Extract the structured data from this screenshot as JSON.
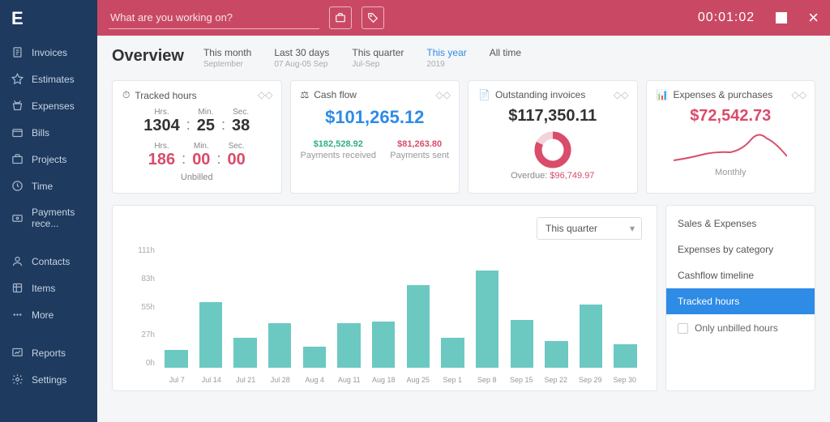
{
  "topbar": {
    "search_placeholder": "What are you working on?",
    "timer": "00:01:02"
  },
  "sidebar": {
    "items": [
      {
        "label": "Invoices",
        "icon": "invoice"
      },
      {
        "label": "Estimates",
        "icon": "estimate"
      },
      {
        "label": "Expenses",
        "icon": "expense"
      },
      {
        "label": "Bills",
        "icon": "bill"
      },
      {
        "label": "Projects",
        "icon": "project"
      },
      {
        "label": "Time",
        "icon": "time"
      },
      {
        "label": "Payments rece...",
        "icon": "payment"
      },
      {
        "label": "Contacts",
        "icon": "contacts"
      },
      {
        "label": "Items",
        "icon": "items"
      },
      {
        "label": "More",
        "icon": "more"
      },
      {
        "label": "Reports",
        "icon": "reports"
      },
      {
        "label": "Settings",
        "icon": "settings"
      }
    ]
  },
  "page_title": "Overview",
  "range_tabs": [
    {
      "label": "This month",
      "sub": "September"
    },
    {
      "label": "Last 30 days",
      "sub": "07 Aug-05 Sep"
    },
    {
      "label": "This quarter",
      "sub": "Jul-Sep"
    },
    {
      "label": "This year",
      "sub": "2019",
      "active": true
    },
    {
      "label": "All time",
      "sub": ""
    }
  ],
  "cards": {
    "tracked": {
      "title": "Tracked hours",
      "labels": {
        "hrs": "Hrs.",
        "min": "Min.",
        "sec": "Sec."
      },
      "total": {
        "h": "1304",
        "m": "25",
        "s": "38"
      },
      "unbilled": {
        "h": "186",
        "m": "00",
        "s": "00"
      },
      "unbilled_label": "Unbilled"
    },
    "cashflow": {
      "title": "Cash flow",
      "amount": "$101,265.12",
      "received": {
        "amount": "$182,528.92",
        "label": "Payments received"
      },
      "sent": {
        "amount": "$81,263.80",
        "label": "Payments sent"
      }
    },
    "outstanding": {
      "title": "Outstanding invoices",
      "amount": "$117,350.11",
      "overdue_label": "Overdue: ",
      "overdue_amount": "$96,749.97"
    },
    "expenses": {
      "title": "Expenses & purchases",
      "amount": "$72,542.73",
      "monthly_label": "Monthly"
    }
  },
  "chart_panel": {
    "dropdown": "This quarter",
    "side_options": [
      "Sales & Expenses",
      "Expenses by category",
      "Cashflow timeline",
      "Tracked hours"
    ],
    "side_active": 3,
    "checkbox_label": "Only unbilled hours"
  },
  "chart_data": {
    "type": "bar",
    "title": "Tracked hours",
    "ylabel": "Hours",
    "ylim": [
      0,
      111
    ],
    "y_ticks": [
      "111h",
      "83h",
      "55h",
      "27h",
      "0h"
    ],
    "categories": [
      "Jul 7",
      "Jul 14",
      "Jul 21",
      "Jul 28",
      "Aug 4",
      "Aug 11",
      "Aug 18",
      "Aug 25",
      "Sep 1",
      "Sep 8",
      "Sep 15",
      "Sep 22",
      "Sep 29",
      "Sep 30"
    ],
    "values": [
      17,
      62,
      28,
      42,
      20,
      42,
      44,
      78,
      28,
      92,
      45,
      25,
      60,
      22
    ]
  }
}
